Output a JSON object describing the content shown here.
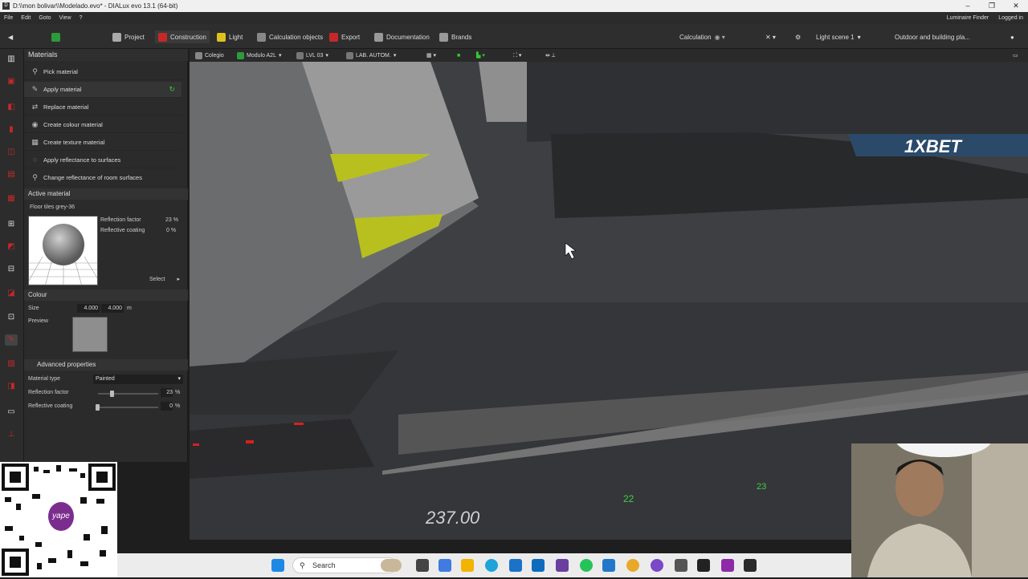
{
  "window": {
    "title": "D:\\\\mon bolivar\\\\Modelado.evo* - DIALux evo 13.1 (64-bit)"
  },
  "menu": {
    "items": [
      "File",
      "Edit",
      "Goto",
      "View",
      "?"
    ],
    "luminaire_finder": "Luminaire Finder",
    "logged_in": "Logged in"
  },
  "toolbar": {
    "tabs": [
      "Project",
      "Construction",
      "Light",
      "Calculation objects",
      "Export",
      "Documentation",
      "Brands"
    ],
    "active_tab": "Construction",
    "calculation": "Calculation",
    "light_scene": "Light scene 1",
    "outdoor": "Outdoor and building pla..."
  },
  "viewbar": {
    "items": [
      "Colegio",
      "Modulo A2L",
      "LVL 03",
      "LAB. AUTOM."
    ]
  },
  "panel": {
    "title": "Materials",
    "actions": [
      "Pick material",
      "Apply material",
      "Replace material",
      "Create colour material",
      "Create texture material",
      "Apply reflectance to surfaces",
      "Change reflectance of room surfaces"
    ],
    "active_material_header": "Active material",
    "material_name": "Floor tiles grey-36",
    "reflection_factor_label": "Reflection factor",
    "reflection_factor_value": "23 %",
    "reflective_coating_label": "Reflective coating",
    "reflective_coating_value": "0 %",
    "select_label": "Select",
    "colour_header": "Colour",
    "size_label": "Size",
    "size_x": "4.000",
    "size_y": "4.000",
    "size_unit": "m",
    "preview_label": "Preview",
    "advanced_header": "Advanced properties",
    "material_type_label": "Material type",
    "material_type_value": "Painted",
    "adv_reflection_label": "Reflection factor",
    "adv_reflection_value": "23",
    "adv_coating_label": "Reflective coating",
    "adv_coating_value": "0",
    "percent": "%"
  },
  "viewport": {
    "dimension": "237.00",
    "label_22": "22",
    "label_23": "23",
    "banner": "1XBET"
  },
  "qr": {
    "brand": "yape"
  },
  "taskbar": {
    "search": "Search"
  }
}
